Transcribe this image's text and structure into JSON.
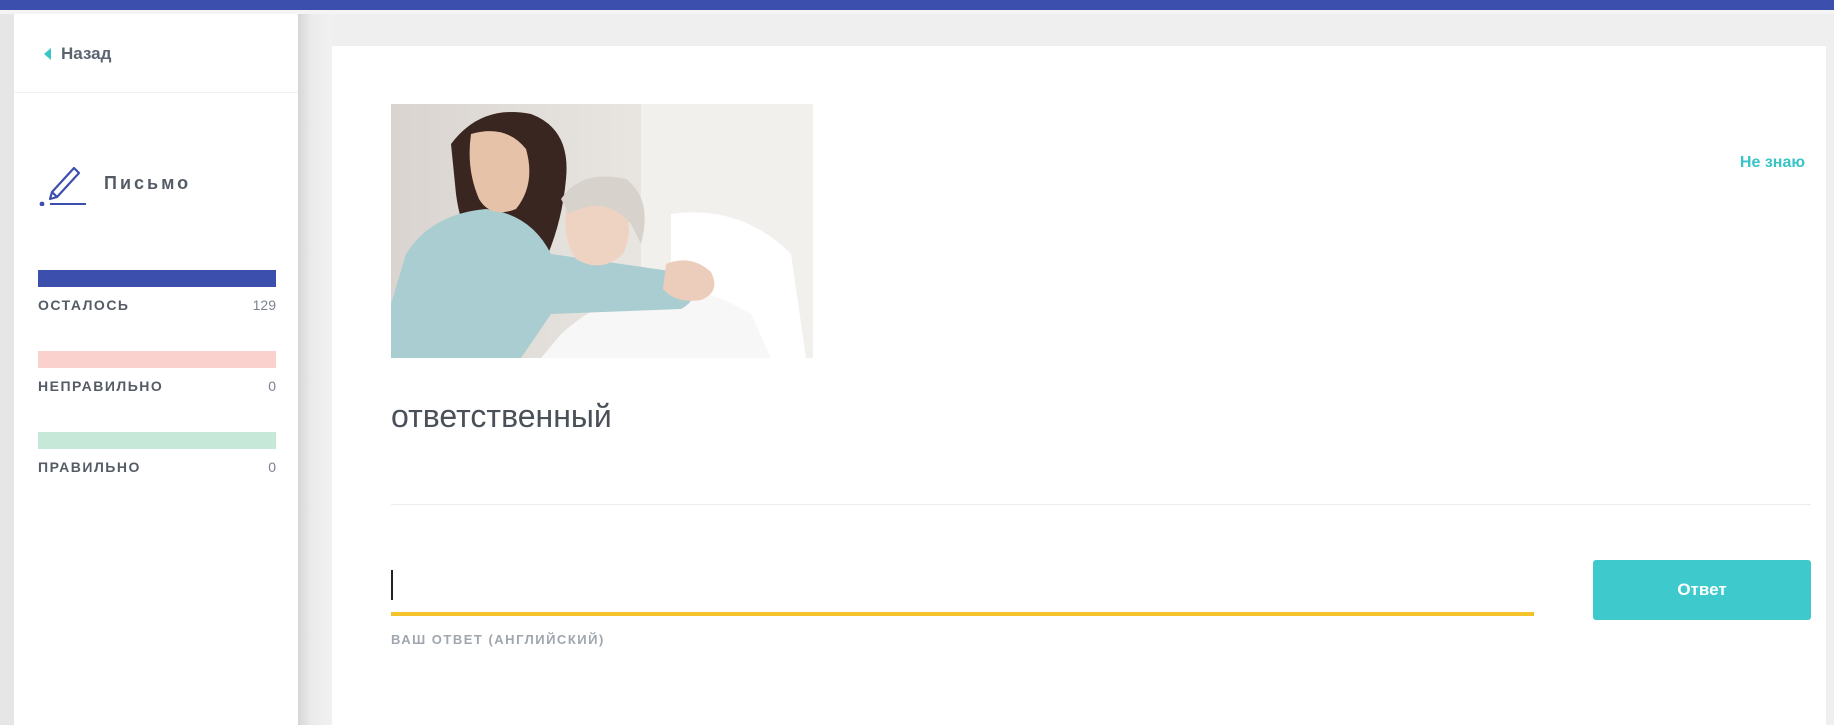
{
  "sidebar": {
    "back_label": "Назад",
    "mode_label": "Письмо",
    "mode_icon": "pen-writing-icon",
    "stats": [
      {
        "label": "ОСТАЛОСЬ",
        "count": "129",
        "color": "#3d4fad"
      },
      {
        "label": "НЕПРАВИЛЬНО",
        "count": "0",
        "color": "#fbd1cd"
      },
      {
        "label": "ПРАВИЛЬНО",
        "count": "0",
        "color": "#c6e8d8"
      }
    ]
  },
  "main": {
    "dont_know_label": "Не знаю",
    "word": "ответственный",
    "answer": {
      "value": "",
      "label": "ВАШ ОТВЕТ (АНГЛИЙСКИЙ)"
    },
    "submit_label": "Ответ"
  },
  "colors": {
    "accent": "#3ec9cc",
    "brand": "#3d4fad",
    "input_underline": "#f4c22a"
  }
}
